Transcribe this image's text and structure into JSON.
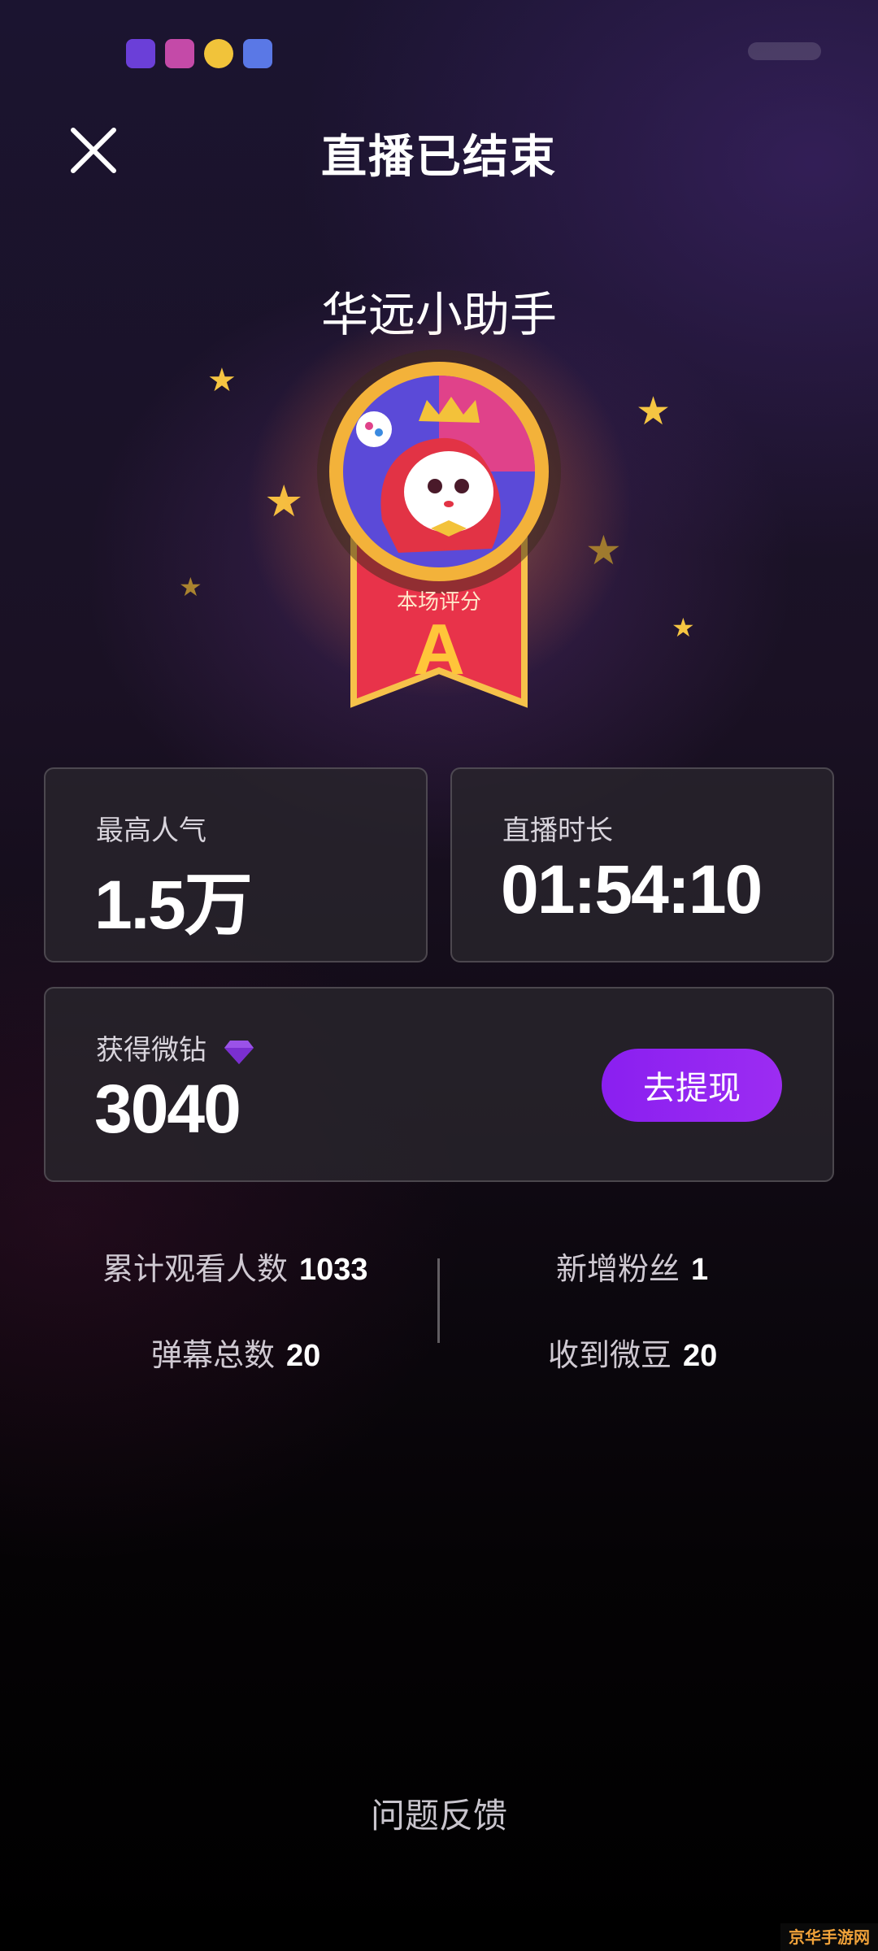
{
  "header": {
    "title": "直播已结束",
    "close_icon": "close-icon"
  },
  "streamer": {
    "name": "华远小助手"
  },
  "medal": {
    "label": "本场评分",
    "grade": "A",
    "colors": {
      "ring": "#f3b23a",
      "ribbon": "#e8334a",
      "grade": "#ffc53a"
    }
  },
  "cards": {
    "peak_popularity": {
      "label": "最高人气",
      "value": "1.5万"
    },
    "duration": {
      "label": "直播时长",
      "value": "01:54:10"
    },
    "diamonds": {
      "label": "获得微钻",
      "value": "3040",
      "icon": "diamond-icon",
      "button": "去提现"
    }
  },
  "stats": {
    "total_viewers": {
      "label": "累计观看人数",
      "value": "1033"
    },
    "new_fans": {
      "label": "新增粉丝",
      "value": "1"
    },
    "danmaku_total": {
      "label": "弹幕总数",
      "value": "20"
    },
    "beans_received": {
      "label": "收到微豆",
      "value": "20"
    }
  },
  "footer": {
    "feedback": "问题反馈"
  },
  "watermark": "京华手游网",
  "colors": {
    "accent": "#8a1ff0",
    "star": "#f5c542"
  }
}
